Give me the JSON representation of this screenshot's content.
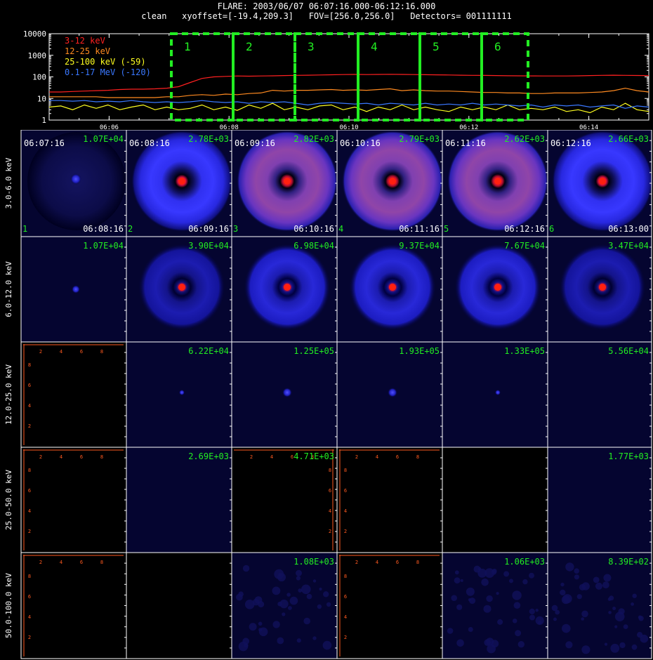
{
  "header": {
    "line1": "FLARE: 2003/06/07 06:07:16.000-06:12:16.000",
    "line2": "clean   xyoffset=[-19.4,209.3]   FOV=[256.0,256.0]   Detectors= 001111111"
  },
  "chart_data": [
    {
      "type": "line",
      "yscale": "log",
      "ylim": [
        1,
        10000
      ],
      "y_ticks": [
        "1",
        "10",
        "100",
        "1000",
        "10000"
      ],
      "x_ticks": [
        "06:06",
        "06:08",
        "06:10",
        "06:12",
        "06:14"
      ],
      "x_range": [
        "06:05",
        "06:15"
      ],
      "series": [
        {
          "name": "3-12 keV",
          "color": "#ff2020",
          "values": [
            20,
            20,
            21,
            22,
            23,
            24,
            26,
            27,
            27,
            28,
            30,
            35,
            55,
            85,
            100,
            105,
            110,
            108,
            110,
            112,
            115,
            118,
            120,
            122,
            125,
            128,
            130,
            128,
            130,
            132,
            130,
            128,
            126,
            124,
            122,
            120,
            118,
            117,
            115,
            113,
            112,
            111,
            110,
            110,
            110,
            112,
            115,
            118,
            120,
            118,
            116,
            115
          ]
        },
        {
          "name": "12-25 keV",
          "color": "#ff8a20",
          "values": [
            12,
            12,
            12,
            12,
            12,
            11,
            11,
            11,
            11,
            11,
            12,
            12,
            14,
            15,
            14,
            16,
            15,
            17,
            18,
            24,
            22,
            24,
            24,
            25,
            26,
            24,
            25,
            24,
            26,
            28,
            23,
            25,
            23,
            22,
            22,
            21,
            20,
            19,
            19,
            18,
            18,
            17,
            17,
            18,
            18,
            18,
            19,
            20,
            23,
            30,
            23,
            20
          ]
        },
        {
          "name": "25-100 keV (-59)",
          "color": "#ffff20",
          "values": [
            4,
            4.5,
            3,
            5,
            3.5,
            5,
            3,
            4,
            5,
            3,
            4,
            3,
            3.5,
            5,
            3,
            4,
            2.8,
            5,
            3.5,
            6,
            3,
            4,
            3,
            4.5,
            5,
            3,
            4,
            2.5,
            4,
            3,
            5,
            3,
            4,
            3,
            2.5,
            4,
            3,
            4,
            3,
            5,
            3,
            3.5,
            3,
            4,
            2.5,
            3,
            2.2,
            4,
            3,
            6,
            3,
            2.5
          ]
        },
        {
          "name": "0.1-17 MeV (-120)",
          "color": "#3a78ff",
          "values": [
            8,
            8,
            7.5,
            8,
            7,
            7.5,
            7,
            8,
            7,
            6.5,
            7,
            6.5,
            7,
            8,
            7,
            6.5,
            7,
            6,
            7,
            6.5,
            7,
            6,
            5,
            6,
            6.5,
            6,
            5.5,
            6,
            5,
            6,
            5.5,
            5,
            6,
            5,
            5.5,
            5,
            6,
            5,
            5.5,
            5,
            4.5,
            5,
            4,
            5,
            4.5,
            5,
            4,
            4.5,
            5,
            3.5,
            4.5,
            4
          ]
        }
      ],
      "intervals": [
        "1",
        "2",
        "3",
        "4",
        "5",
        "6"
      ]
    },
    {
      "type": "heatmap",
      "row_labels": [
        "3.0-6.0 keV",
        "6.0-12.0 keV",
        "12.0-25.0 keV",
        "25.0-50.0 keV",
        "50.0-100.0 keV"
      ],
      "columns": [
        {
          "start": "06:07:16",
          "end": "06:08:16",
          "index": "1"
        },
        {
          "start": "06:08:16",
          "end": "06:09:16",
          "index": "2"
        },
        {
          "start": "06:09:16",
          "end": "06:10:16",
          "index": "3"
        },
        {
          "start": "06:10:16",
          "end": "06:11:16",
          "index": "4"
        },
        {
          "start": "06:11:16",
          "end": "06:12:16",
          "index": "5"
        },
        {
          "start": "06:12:16",
          "end": "06:13:00",
          "index": "6"
        }
      ],
      "max_values": [
        [
          "1.07E+04",
          "2.78E+03",
          "2.82E+03",
          "2.79E+03",
          "2.62E+03",
          "2.66E+03"
        ],
        [
          "1.07E+04",
          "3.90E+04",
          "6.98E+04",
          "9.37E+04",
          "7.67E+04",
          "3.47E+04"
        ],
        [
          "",
          "6.22E+04",
          "1.25E+05",
          "1.93E+05",
          "1.33E+05",
          "5.56E+04"
        ],
        [
          "",
          "2.69E+03",
          "4.71E+03",
          "",
          "",
          "1.77E+03"
        ],
        [
          "",
          "",
          "1.08E+03",
          "",
          "1.06E+03",
          "8.39E+02"
        ]
      ],
      "cell_kind": [
        [
          "faint",
          "ring-blue",
          "ring-red",
          "ring-red",
          "ring-red",
          "ring-blue"
        ],
        [
          "dot",
          "ring-dark",
          "ring-mid",
          "ring-mid",
          "ring-mid",
          "ring-dark"
        ],
        [
          "empty-axes",
          "tiny",
          "dot-small",
          "dot-small",
          "tiny",
          "plain"
        ],
        [
          "empty-axes",
          "plain",
          "empty-axes-right",
          "empty-axes",
          "empty",
          "plain"
        ],
        [
          "empty-axes",
          "empty",
          "noise",
          "empty-axes",
          "noise",
          "noise"
        ]
      ],
      "axis_ticks": [
        "2",
        "4",
        "6",
        "8"
      ]
    }
  ]
}
